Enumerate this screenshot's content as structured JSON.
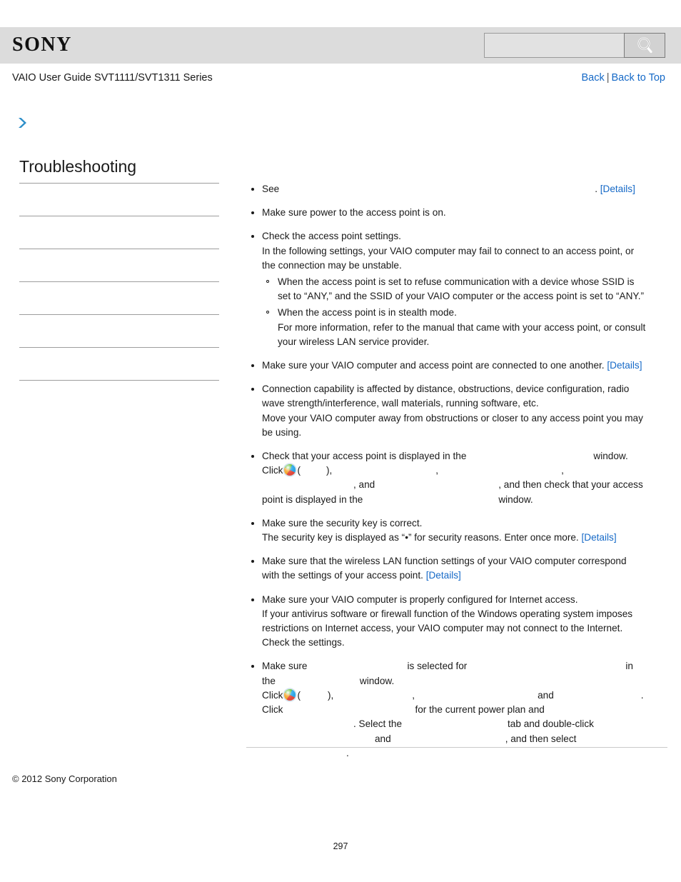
{
  "header": {
    "logo_text": "SONY",
    "search": {
      "value": "",
      "placeholder": "",
      "icon": "search-icon",
      "button_label": ""
    }
  },
  "subheader": {
    "guide_title": "VAIO User Guide SVT1111/SVT1311 Series",
    "back_label": "Back",
    "separator": "|",
    "back_to_top_label": "Back to Top"
  },
  "sidebar": {
    "expand_icon": "chevron-right-icon",
    "title": "Troubleshooting",
    "items": [
      {
        "label": ""
      },
      {
        "label": ""
      },
      {
        "label": ""
      },
      {
        "label": ""
      },
      {
        "label": ""
      },
      {
        "label": ""
      }
    ]
  },
  "content": {
    "details_label": "[Details]",
    "start_orb_icon": "windows-start-orb-icon",
    "bullets": [
      {
        "id": "see-details",
        "line1_a": "See",
        "line1_gap": 442,
        "line1_b": ". "
      },
      {
        "id": "power-on",
        "line1": "Make sure power to the access point is on."
      },
      {
        "id": "check-ap-settings",
        "line1": "Check the access point settings.",
        "line2": "In the following settings, your VAIO computer may fail to connect to an access point, or",
        "line3": "the connection may be unstable.",
        "sub": [
          {
            "line1": "When the access point is set to refuse communication with a device whose SSID is",
            "line2": "set to “ANY,” and the SSID of your VAIO computer or the access point is set to “ANY.”"
          },
          {
            "line1": "When the access point is in stealth mode.",
            "line2": "For more information, refer to the manual that came with your access point, or consult",
            "line3": "your wireless LAN service provider."
          }
        ]
      },
      {
        "id": "connected-to-one-another",
        "line1": "Make sure your VAIO computer and access point are connected to one another. "
      },
      {
        "id": "connection-capability",
        "line1": "Connection capability is affected by distance, obstructions, device configuration, radio",
        "line2": "wave strength/interference, wall materials, running software, etc.",
        "line3": "Move your VAIO computer away from obstructions or closer to any access point you may",
        "line4": "be using."
      },
      {
        "id": "check-ap-displayed",
        "l1_a": "Check that your access point is displayed in the",
        "l1_gap": 178,
        "l1_b": "window.",
        "l2_a": "Click",
        "l2_b": "(",
        "l2_gap1": 36,
        "l2_c": "),",
        "l2_gap2": 145,
        "l2_d": ",",
        "l2_gap3": 172,
        "l2_e": ",",
        "l3_gap1": 128,
        "l3_a": ", and",
        "l3_gap2": 173,
        "l3_b": ", and then check that your access",
        "l4_a": "point is displayed in the",
        "l4_gap": 190,
        "l4_b": "window."
      },
      {
        "id": "security-key",
        "line1": "Make sure the security key is correct.",
        "line2": "The security key is displayed as “•” for security reasons. Enter once more. "
      },
      {
        "id": "wlan-settings-correspond",
        "line1": "Make sure that the wireless LAN function settings of your VAIO computer correspond",
        "line2": "with the settings of your access point. "
      },
      {
        "id": "internet-access-config",
        "line1": "Make sure your VAIO computer is properly configured for Internet access.",
        "line2": "If your antivirus software or firewall function of the Windows operating system imposes",
        "line3": "restrictions on Internet access, your VAIO computer may not connect to the Internet.",
        "line4": "Check the settings."
      },
      {
        "id": "power-plan-wireless-adapter",
        "l1_a": "Make sure",
        "l1_gap1": 140,
        "l1_b": "is selected for",
        "l1_gap2": 222,
        "l1_c": "in",
        "l2_a": "the",
        "l2_gap": 118,
        "l2_b": "window.",
        "l3_a": "Click",
        "l3_b": "(",
        "l3_gap1": 38,
        "l3_c": "),",
        "l3_gap2": 110,
        "l3_d": ",",
        "l3_gap3": 172,
        "l3_e": "and",
        "l3_gap4": 122,
        "l3_f": ".",
        "l4_a": "Click",
        "l4_gap": 185,
        "l4_b": "for the current power plan and",
        "l5_gap1": 128,
        "l5_a": ". Select the",
        "l5_gap2": 148,
        "l5_b": "tab and double-click",
        "l6_gap1": 158,
        "l6_a": "and",
        "l6_gap2": 160,
        "l6_b": ", and then select",
        "l7_gap": 118,
        "l7_a": "."
      }
    ]
  },
  "footer": {
    "copyright": "© 2012 Sony Corporation",
    "page_number": "297"
  },
  "colors": {
    "banner_bg": "#dcdcdc",
    "link_blue": "#1569c7",
    "rule_gray": "#9d9d9d",
    "chevron_blue": "#2e8fc9"
  }
}
